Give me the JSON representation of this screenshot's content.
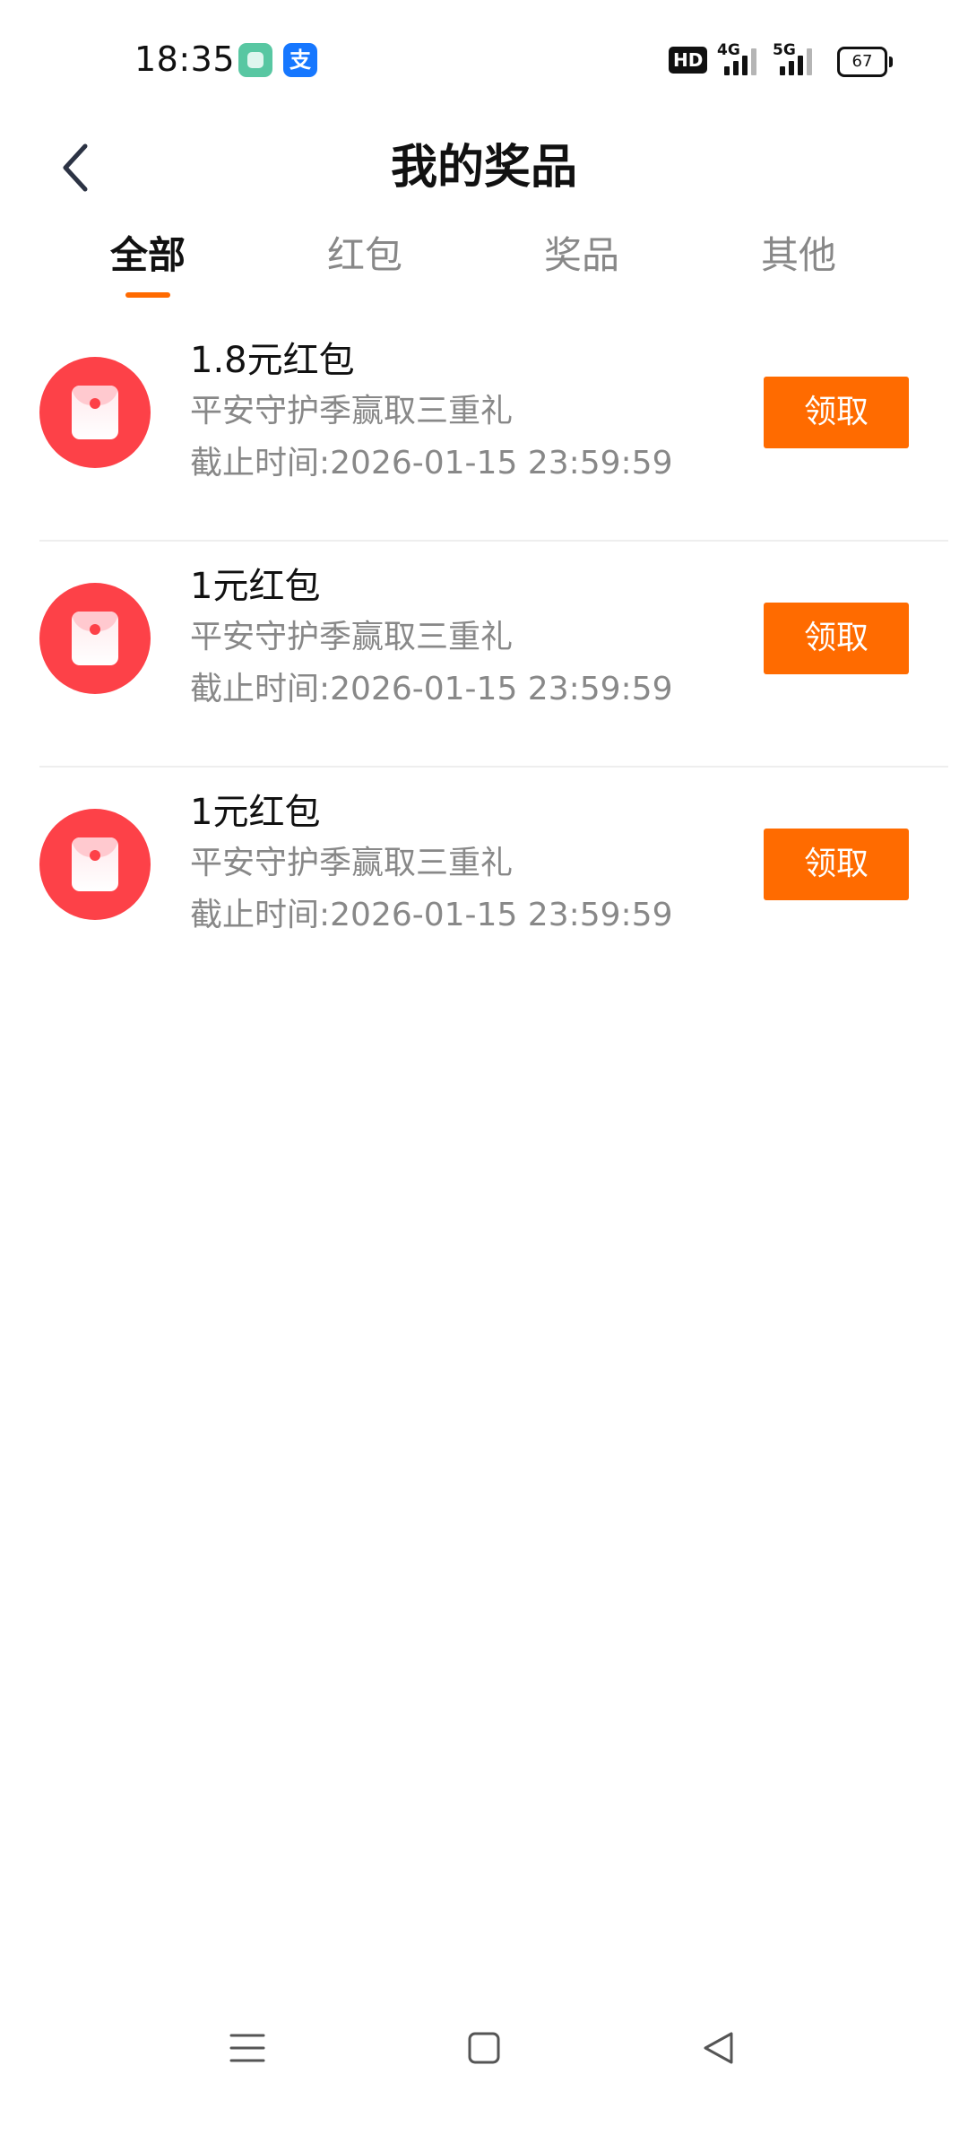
{
  "status_bar": {
    "time": "18:35",
    "app_icon_b_glyph": "支",
    "hd_label": "HD",
    "signal_4g_label": "4G",
    "signal_5g_label": "5G",
    "battery_level": "67"
  },
  "header": {
    "title": "我的奖品"
  },
  "tabs": [
    {
      "label": "全部",
      "active": true
    },
    {
      "label": "红包",
      "active": false
    },
    {
      "label": "奖品",
      "active": false
    },
    {
      "label": "其他",
      "active": false
    }
  ],
  "prizes": [
    {
      "name": "1.8元红包",
      "description": "平安守护季赢取三重礼",
      "deadline": "截止时间:2026-01-15 23:59:59",
      "button_label": "领取"
    },
    {
      "name": "1元红包",
      "description": "平安守护季赢取三重礼",
      "deadline": "截止时间:2026-01-15 23:59:59",
      "button_label": "领取"
    },
    {
      "name": "1元红包",
      "description": "平安守护季赢取三重礼",
      "deadline": "截止时间:2026-01-15 23:59:59",
      "button_label": "领取"
    }
  ],
  "colors": {
    "accent": "#ff6b00",
    "tab_indicator": "#ff6a00",
    "red_envelope": "#fd4148",
    "secondary_text": "#888888"
  },
  "icons": {
    "back": "chevron-left-icon",
    "prize": "red-envelope-icon",
    "system_menu": "menu-lines-icon",
    "system_home": "square-home-icon",
    "system_back": "triangle-back-icon"
  }
}
